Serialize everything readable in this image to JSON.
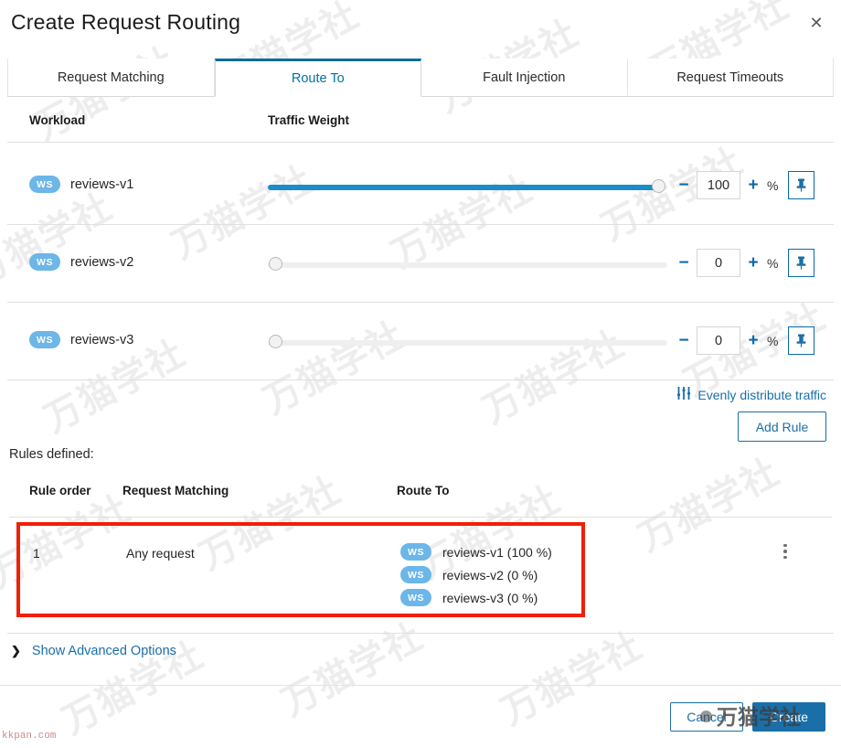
{
  "modal": {
    "title": "Create Request Routing",
    "close_label": "✕"
  },
  "tabs": [
    {
      "label": "Request Matching",
      "active": false
    },
    {
      "label": "Route To",
      "active": true
    },
    {
      "label": "Fault Injection",
      "active": false
    },
    {
      "label": "Request Timeouts",
      "active": false
    }
  ],
  "workload_table": {
    "headers": {
      "workload": "Workload",
      "traffic_weight": "Traffic Weight"
    },
    "rows": [
      {
        "badge": "WS",
        "name": "reviews-v1",
        "weight": "100",
        "weight_pct": 100,
        "unit": "%"
      },
      {
        "badge": "WS",
        "name": "reviews-v2",
        "weight": "0",
        "weight_pct": 0,
        "unit": "%"
      },
      {
        "badge": "WS",
        "name": "reviews-v3",
        "weight": "0",
        "weight_pct": 0,
        "unit": "%"
      }
    ],
    "decrement_label": "−",
    "increment_label": "+",
    "pin_icon": "pin-icon"
  },
  "actions": {
    "evenly_distribute": "Evenly distribute traffic",
    "evenly_icon": "sliders-icon",
    "add_rule": "Add Rule"
  },
  "rules": {
    "label": "Rules defined:",
    "headers": {
      "rule_order": "Rule order",
      "request_matching": "Request Matching",
      "route_to": "Route To"
    },
    "items": [
      {
        "order": "1",
        "matching": "Any request",
        "routes": [
          {
            "badge": "WS",
            "label": "reviews-v1 (100 %)"
          },
          {
            "badge": "WS",
            "label": "reviews-v2 (0 %)"
          },
          {
            "badge": "WS",
            "label": "reviews-v3 (0 %)"
          }
        ],
        "menu_icon": "kebab-menu-icon",
        "highlighted": true
      }
    ]
  },
  "advanced": {
    "label": "Show Advanced Options",
    "chevron": "❯"
  },
  "footer": {
    "cancel": "Cancel",
    "create": "Create"
  },
  "watermark": {
    "text": "万猫学社",
    "corner": "kkpan.com"
  },
  "colors": {
    "accent": "#1a6fa8",
    "tab_active": "#0072a3",
    "slider_fill": "#1a8cc8",
    "badge": "#6cb6e8",
    "highlight_border": "#f01f07",
    "primary_button": "#1a6fa8"
  }
}
